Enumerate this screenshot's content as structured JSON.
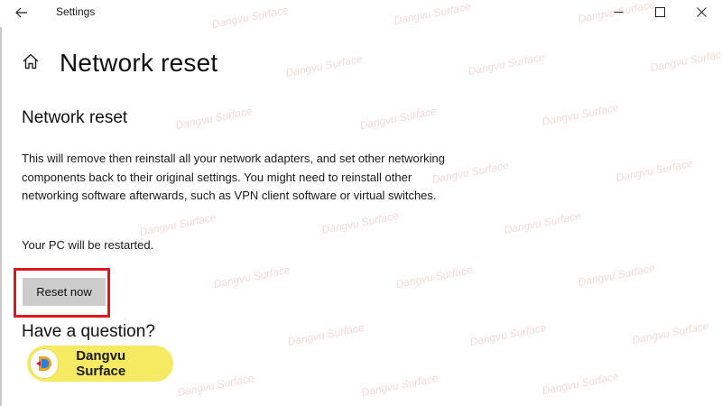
{
  "window": {
    "app_title": "Settings",
    "icons": {
      "back": "back-arrow-icon",
      "minimize": "minimize-icon",
      "maximize": "maximize-icon",
      "close": "close-icon",
      "home": "home-icon"
    }
  },
  "page": {
    "title": "Network reset"
  },
  "section": {
    "title": "Network reset",
    "description": "This will remove then reinstall all your network adapters, and set other networking components back to their original settings. You might need to reinstall other networking software afterwards, such as VPN client software or virtual switches.",
    "restart_note": "Your PC will be restarted.",
    "reset_button_label": "Reset now"
  },
  "help": {
    "title": "Have a question?"
  },
  "brand": {
    "name": "Dangvu Surface",
    "watermark": "Dangvu Surface"
  },
  "colors": {
    "highlight": "#e0161d",
    "button_bg": "#cccccc",
    "badge_bg": "#f7ea63"
  }
}
